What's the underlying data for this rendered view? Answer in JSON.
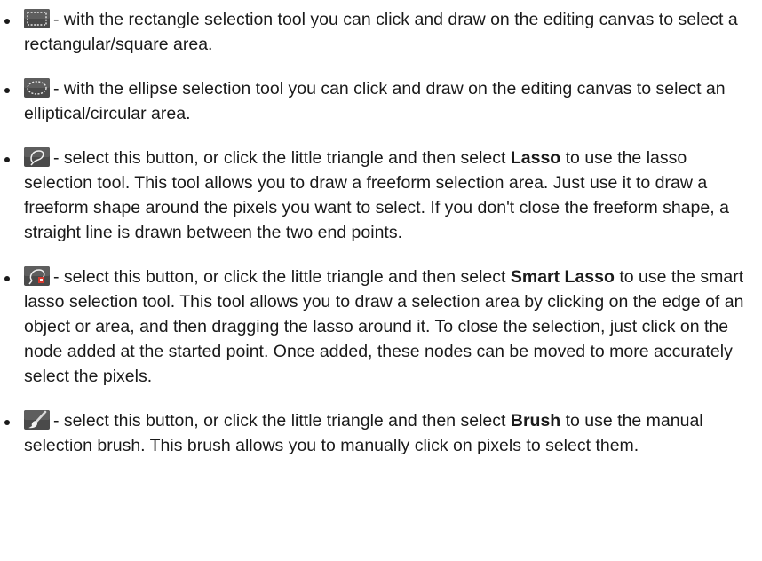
{
  "items": [
    {
      "icon": "rectangle-selection-icon",
      "text": "- with the rectangle selection tool you can click and draw on the editing canvas to select a rectangular/square area."
    },
    {
      "icon": "ellipse-selection-icon",
      "text": "- with the ellipse selection tool you can click and draw on the editing canvas to select an elliptical/circular area."
    },
    {
      "icon": "lasso-icon",
      "text_before": "- select this button, or click the little triangle and then select ",
      "keyword": "Lasso",
      "text_after": " to use the lasso selection tool. This tool allows you to draw a freeform selection area. Just use it to draw a freeform shape around the pixels you want to select. If you don't close the freeform shape, a straight line is drawn between the two end points."
    },
    {
      "icon": "smart-lasso-icon",
      "text_before": "- select this button, or click the little triangle and then select ",
      "keyword": "Smart Lasso",
      "text_after": " to use the smart lasso selection tool. This tool allows you to draw a selection area by clicking on the edge of an object or area, and then dragging the lasso around it. To close the selection, just click on the node added at the started point. Once added, these nodes can be moved to more accurately select the pixels."
    },
    {
      "icon": "selection-brush-icon",
      "text_before": "- select this button, or click the little triangle and then select ",
      "keyword": "Brush",
      "text_after": " to use the manual selection brush. This brush allows you to manually click on pixels to select them."
    }
  ]
}
